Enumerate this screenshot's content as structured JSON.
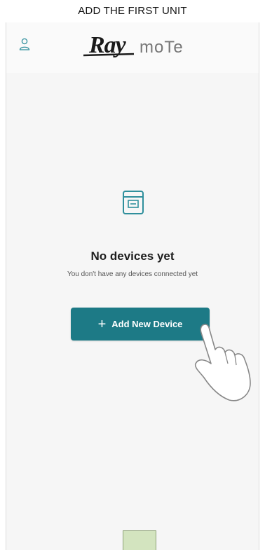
{
  "caption": "ADD THE FIRST UNIT",
  "header": {
    "logo_ray": "Ray",
    "logo_mote": "moTe",
    "user_icon": "user-icon"
  },
  "empty_state": {
    "icon": "device-box-icon",
    "title": "No devices yet",
    "subtitle": "You don't have any devices connected yet"
  },
  "add_button": {
    "plus": "+",
    "label": "Add New Device"
  },
  "colors": {
    "accent": "#1d7a86",
    "background": "#f6f6f6",
    "bottom_square": "#d3e4bf"
  }
}
